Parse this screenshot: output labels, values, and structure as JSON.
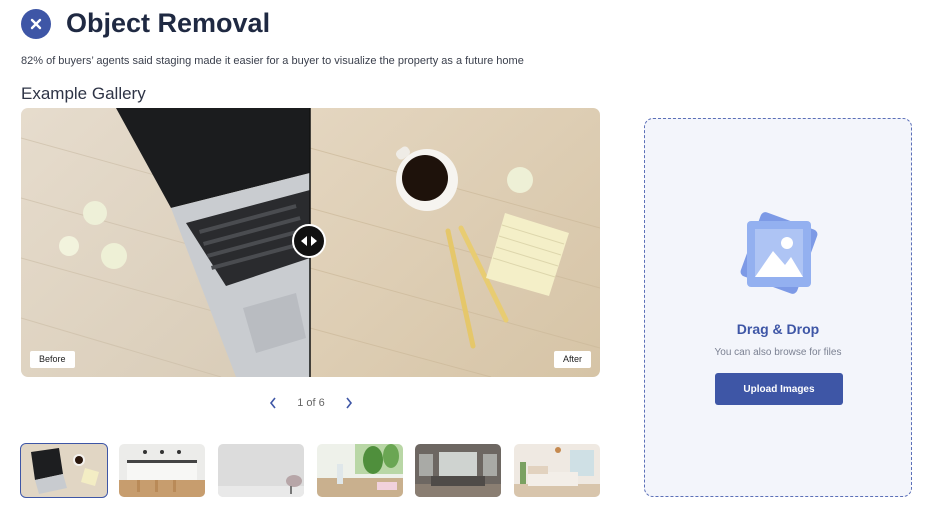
{
  "header": {
    "title": "Object Removal",
    "subtitle": "82% of buyers’ agents said staging made it easier for a buyer to visualize the property as a future home"
  },
  "gallery": {
    "heading": "Example Gallery",
    "before_label": "Before",
    "after_label": "After",
    "pager_text": "1 of 6",
    "thumbnails": [
      {
        "name": "Desk with laptop"
      },
      {
        "name": "Kitchen"
      },
      {
        "name": "Empty room"
      },
      {
        "name": "Plants on table"
      },
      {
        "name": "Living room"
      },
      {
        "name": "Bedroom"
      }
    ]
  },
  "upload": {
    "title": "Drag & Drop",
    "hint": "You can also browse for files",
    "button_label": "Upload Images"
  },
  "colors": {
    "accent": "#3e56a6",
    "heading": "#1f2942",
    "dropzone_bg": "#f3f5fb"
  },
  "icons": [
    "close-icon",
    "slider-arrows-icon",
    "chevron-left-icon",
    "chevron-right-icon",
    "image-upload-icon"
  ]
}
